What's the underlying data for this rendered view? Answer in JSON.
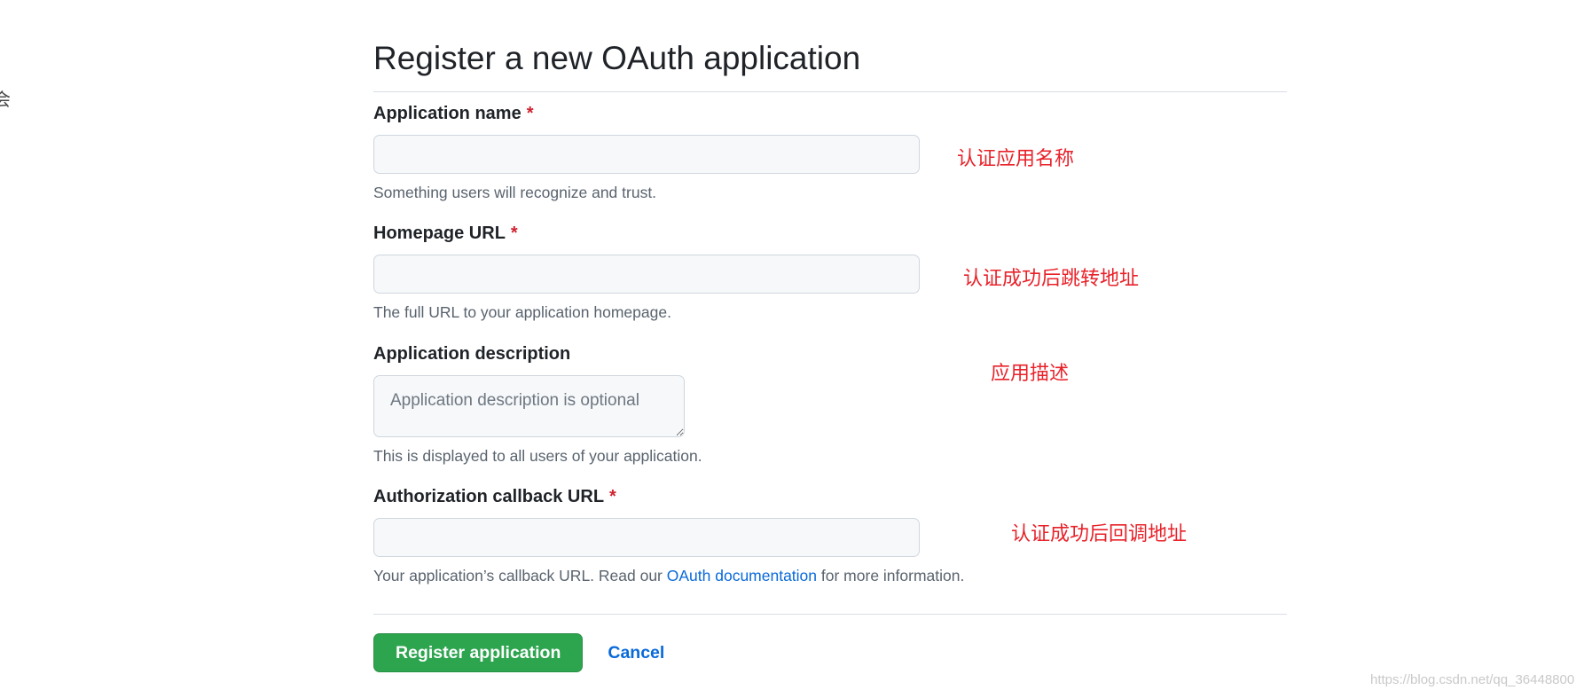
{
  "edge_glyph": "会",
  "page_title": "Register a new OAuth application",
  "fields": {
    "app_name": {
      "label": "Application name",
      "required_mark": "*",
      "value": "",
      "hint": "Something users will recognize and trust."
    },
    "homepage_url": {
      "label": "Homepage URL",
      "required_mark": "*",
      "value": "",
      "hint": "The full URL to your application homepage."
    },
    "app_description": {
      "label": "Application description",
      "placeholder": "Application description is optional",
      "hint": "This is displayed to all users of your application."
    },
    "callback_url": {
      "label": "Authorization callback URL",
      "required_mark": "*",
      "value": "",
      "hint_before": "Your application’s callback URL. Read our ",
      "hint_link": "OAuth documentation",
      "hint_after": " for more information."
    }
  },
  "actions": {
    "register_label": "Register application",
    "cancel_label": "Cancel"
  },
  "annotations": {
    "app_name": "认证应用名称",
    "homepage_url": "认证成功后跳转地址",
    "app_description": "应用描述",
    "callback_url": "认证成功后回调地址"
  },
  "watermark": "https://blog.csdn.net/qq_36448800",
  "colors": {
    "primary_button": "#2da44e",
    "link": "#0969da",
    "required": "#cf222e",
    "annotation": "#e8222a"
  }
}
